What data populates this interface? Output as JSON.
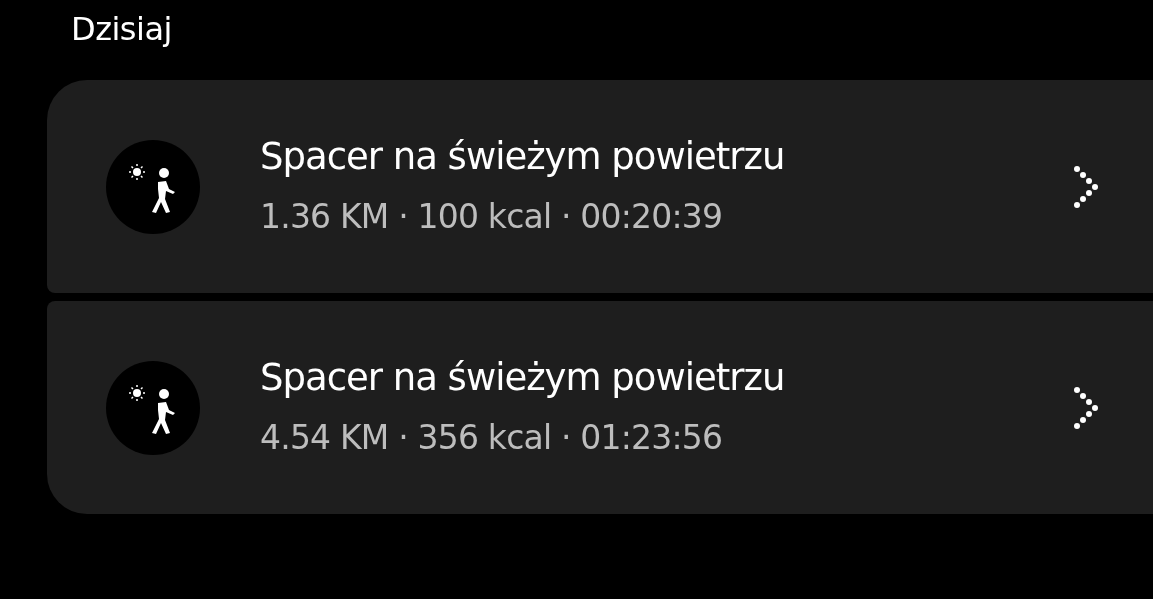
{
  "section_title": "Dzisiaj",
  "activities": [
    {
      "title": "Spacer na świeżym powietrzu",
      "details": "1.36 KM · 100 kcal · 00:20:39"
    },
    {
      "title": "Spacer na świeżym powietrzu",
      "details": "4.54 KM · 356 kcal · 01:23:56"
    }
  ]
}
